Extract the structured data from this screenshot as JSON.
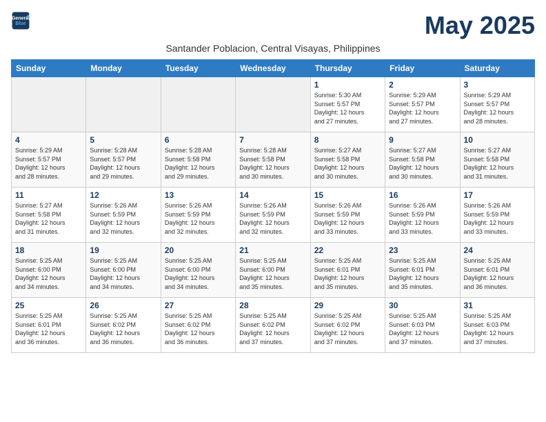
{
  "logo": {
    "line1": "General",
    "line2": "Blue"
  },
  "title": "May 2025",
  "subtitle": "Santander Poblacion, Central Visayas, Philippines",
  "weekdays": [
    "Sunday",
    "Monday",
    "Tuesday",
    "Wednesday",
    "Thursday",
    "Friday",
    "Saturday"
  ],
  "weeks": [
    [
      {
        "day": "",
        "info": ""
      },
      {
        "day": "",
        "info": ""
      },
      {
        "day": "",
        "info": ""
      },
      {
        "day": "",
        "info": ""
      },
      {
        "day": "1",
        "info": "Sunrise: 5:30 AM\nSunset: 5:57 PM\nDaylight: 12 hours\nand 27 minutes."
      },
      {
        "day": "2",
        "info": "Sunrise: 5:29 AM\nSunset: 5:57 PM\nDaylight: 12 hours\nand 27 minutes."
      },
      {
        "day": "3",
        "info": "Sunrise: 5:29 AM\nSunset: 5:57 PM\nDaylight: 12 hours\nand 28 minutes."
      }
    ],
    [
      {
        "day": "4",
        "info": "Sunrise: 5:29 AM\nSunset: 5:57 PM\nDaylight: 12 hours\nand 28 minutes."
      },
      {
        "day": "5",
        "info": "Sunrise: 5:28 AM\nSunset: 5:57 PM\nDaylight: 12 hours\nand 29 minutes."
      },
      {
        "day": "6",
        "info": "Sunrise: 5:28 AM\nSunset: 5:58 PM\nDaylight: 12 hours\nand 29 minutes."
      },
      {
        "day": "7",
        "info": "Sunrise: 5:28 AM\nSunset: 5:58 PM\nDaylight: 12 hours\nand 30 minutes."
      },
      {
        "day": "8",
        "info": "Sunrise: 5:27 AM\nSunset: 5:58 PM\nDaylight: 12 hours\nand 30 minutes."
      },
      {
        "day": "9",
        "info": "Sunrise: 5:27 AM\nSunset: 5:58 PM\nDaylight: 12 hours\nand 30 minutes."
      },
      {
        "day": "10",
        "info": "Sunrise: 5:27 AM\nSunset: 5:58 PM\nDaylight: 12 hours\nand 31 minutes."
      }
    ],
    [
      {
        "day": "11",
        "info": "Sunrise: 5:27 AM\nSunset: 5:58 PM\nDaylight: 12 hours\nand 31 minutes."
      },
      {
        "day": "12",
        "info": "Sunrise: 5:26 AM\nSunset: 5:59 PM\nDaylight: 12 hours\nand 32 minutes."
      },
      {
        "day": "13",
        "info": "Sunrise: 5:26 AM\nSunset: 5:59 PM\nDaylight: 12 hours\nand 32 minutes."
      },
      {
        "day": "14",
        "info": "Sunrise: 5:26 AM\nSunset: 5:59 PM\nDaylight: 12 hours\nand 32 minutes."
      },
      {
        "day": "15",
        "info": "Sunrise: 5:26 AM\nSunset: 5:59 PM\nDaylight: 12 hours\nand 33 minutes."
      },
      {
        "day": "16",
        "info": "Sunrise: 5:26 AM\nSunset: 5:59 PM\nDaylight: 12 hours\nand 33 minutes."
      },
      {
        "day": "17",
        "info": "Sunrise: 5:26 AM\nSunset: 5:59 PM\nDaylight: 12 hours\nand 33 minutes."
      }
    ],
    [
      {
        "day": "18",
        "info": "Sunrise: 5:25 AM\nSunset: 6:00 PM\nDaylight: 12 hours\nand 34 minutes."
      },
      {
        "day": "19",
        "info": "Sunrise: 5:25 AM\nSunset: 6:00 PM\nDaylight: 12 hours\nand 34 minutes."
      },
      {
        "day": "20",
        "info": "Sunrise: 5:25 AM\nSunset: 6:00 PM\nDaylight: 12 hours\nand 34 minutes."
      },
      {
        "day": "21",
        "info": "Sunrise: 5:25 AM\nSunset: 6:00 PM\nDaylight: 12 hours\nand 35 minutes."
      },
      {
        "day": "22",
        "info": "Sunrise: 5:25 AM\nSunset: 6:01 PM\nDaylight: 12 hours\nand 35 minutes."
      },
      {
        "day": "23",
        "info": "Sunrise: 5:25 AM\nSunset: 6:01 PM\nDaylight: 12 hours\nand 35 minutes."
      },
      {
        "day": "24",
        "info": "Sunrise: 5:25 AM\nSunset: 6:01 PM\nDaylight: 12 hours\nand 36 minutes."
      }
    ],
    [
      {
        "day": "25",
        "info": "Sunrise: 5:25 AM\nSunset: 6:01 PM\nDaylight: 12 hours\nand 36 minutes."
      },
      {
        "day": "26",
        "info": "Sunrise: 5:25 AM\nSunset: 6:02 PM\nDaylight: 12 hours\nand 36 minutes."
      },
      {
        "day": "27",
        "info": "Sunrise: 5:25 AM\nSunset: 6:02 PM\nDaylight: 12 hours\nand 36 minutes."
      },
      {
        "day": "28",
        "info": "Sunrise: 5:25 AM\nSunset: 6:02 PM\nDaylight: 12 hours\nand 37 minutes."
      },
      {
        "day": "29",
        "info": "Sunrise: 5:25 AM\nSunset: 6:02 PM\nDaylight: 12 hours\nand 37 minutes."
      },
      {
        "day": "30",
        "info": "Sunrise: 5:25 AM\nSunset: 6:03 PM\nDaylight: 12 hours\nand 37 minutes."
      },
      {
        "day": "31",
        "info": "Sunrise: 5:25 AM\nSunset: 6:03 PM\nDaylight: 12 hours\nand 37 minutes."
      }
    ]
  ],
  "colors": {
    "header_bg": "#2e7bc4",
    "logo_dark": "#1a3a5c",
    "logo_blue": "#2e7bc4"
  }
}
